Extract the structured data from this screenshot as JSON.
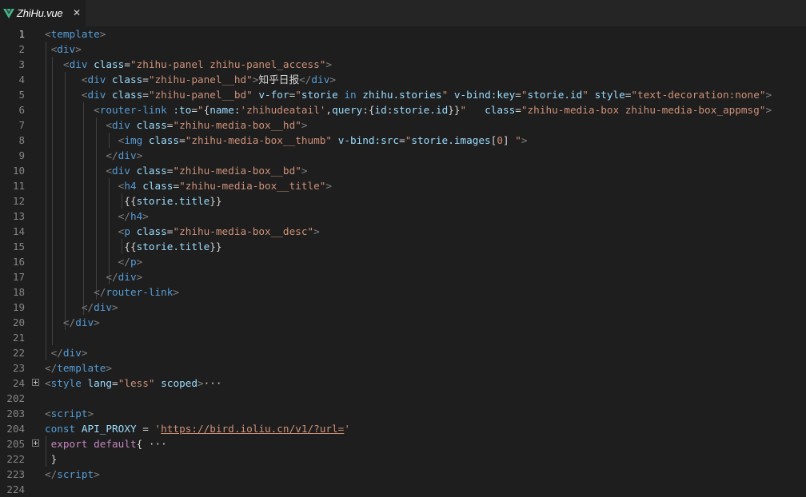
{
  "tab": {
    "filename": "ZhiHu.vue",
    "close_glyph": "✕",
    "icon": "vue-icon"
  },
  "colors": {
    "tag": "#569cd6",
    "attribute": "#9cdcfe",
    "string": "#ce9178",
    "punctuation": "#808080",
    "text": "#d4d4d4",
    "keyword": "#c586c0",
    "line_number": "#858585",
    "background": "#1e1e1e"
  },
  "lines": [
    {
      "n": "1",
      "t": [
        [
          "p",
          "<"
        ],
        [
          "tag",
          "template"
        ],
        [
          "p",
          ">"
        ]
      ]
    },
    {
      "n": "2",
      "t": [
        [
          "txt",
          " "
        ],
        [
          "p",
          "<"
        ],
        [
          "tag",
          "div"
        ],
        [
          "p",
          ">"
        ]
      ]
    },
    {
      "n": "3",
      "t": [
        [
          "txt",
          "   "
        ],
        [
          "p",
          "<"
        ],
        [
          "tag",
          "div"
        ],
        [
          "txt",
          " "
        ],
        [
          "attr",
          "class"
        ],
        [
          "txt",
          "="
        ],
        [
          "str",
          "\"zhihu-panel zhihu-panel_access\""
        ],
        [
          "p",
          ">"
        ]
      ]
    },
    {
      "n": "4",
      "t": [
        [
          "txt",
          "      "
        ],
        [
          "p",
          "<"
        ],
        [
          "tag",
          "div"
        ],
        [
          "txt",
          " "
        ],
        [
          "attr",
          "class"
        ],
        [
          "txt",
          "="
        ],
        [
          "str",
          "\"zhihu-panel__hd\""
        ],
        [
          "p",
          ">"
        ],
        [
          "txt",
          "知乎日报"
        ],
        [
          "p",
          "</"
        ],
        [
          "tag",
          "div"
        ],
        [
          "p",
          ">"
        ]
      ]
    },
    {
      "n": "5",
      "t": [
        [
          "txt",
          "      "
        ],
        [
          "p",
          "<"
        ],
        [
          "tag",
          "div"
        ],
        [
          "txt",
          " "
        ],
        [
          "attr",
          "class"
        ],
        [
          "txt",
          "="
        ],
        [
          "str",
          "\"zhihu-panel__bd\""
        ],
        [
          "txt",
          " "
        ],
        [
          "attr",
          "v-for"
        ],
        [
          "txt",
          "="
        ],
        [
          "str",
          "\""
        ],
        [
          "var",
          "storie"
        ],
        [
          "txt",
          " "
        ],
        [
          "tag",
          "in"
        ],
        [
          "txt",
          " "
        ],
        [
          "var",
          "zhihu.stories"
        ],
        [
          "str",
          "\""
        ],
        [
          "txt",
          " "
        ],
        [
          "attr",
          "v-bind:key"
        ],
        [
          "txt",
          "="
        ],
        [
          "str",
          "\""
        ],
        [
          "var",
          "storie.id"
        ],
        [
          "str",
          "\""
        ],
        [
          "txt",
          " "
        ],
        [
          "attr",
          "style"
        ],
        [
          "txt",
          "="
        ],
        [
          "str",
          "\"text-decoration:none\""
        ],
        [
          "p",
          ">"
        ]
      ]
    },
    {
      "n": "6",
      "t": [
        [
          "txt",
          "        "
        ],
        [
          "p",
          "<"
        ],
        [
          "tag",
          "router-link"
        ],
        [
          "txt",
          " "
        ],
        [
          "attr",
          ":to"
        ],
        [
          "txt",
          "="
        ],
        [
          "str",
          "\""
        ],
        [
          "txt",
          "{"
        ],
        [
          "var",
          "name"
        ],
        [
          "txt",
          ":"
        ],
        [
          "str",
          "'zhihudeatail'"
        ],
        [
          "txt",
          ","
        ],
        [
          "var",
          "query"
        ],
        [
          "txt",
          ":{"
        ],
        [
          "var",
          "id"
        ],
        [
          "txt",
          ":"
        ],
        [
          "var",
          "storie.id"
        ],
        [
          "txt",
          "}}"
        ],
        [
          "str",
          "\""
        ],
        [
          "txt",
          "   "
        ],
        [
          "attr",
          "class"
        ],
        [
          "txt",
          "="
        ],
        [
          "str",
          "\"zhihu-media-box zhihu-media-box_appmsg\""
        ],
        [
          "p",
          ">"
        ]
      ]
    },
    {
      "n": "7",
      "t": [
        [
          "txt",
          "          "
        ],
        [
          "p",
          "<"
        ],
        [
          "tag",
          "div"
        ],
        [
          "txt",
          " "
        ],
        [
          "attr",
          "class"
        ],
        [
          "txt",
          "="
        ],
        [
          "str",
          "\"zhihu-media-box__hd\""
        ],
        [
          "p",
          ">"
        ]
      ]
    },
    {
      "n": "8",
      "t": [
        [
          "txt",
          "            "
        ],
        [
          "p",
          "<"
        ],
        [
          "tag",
          "img"
        ],
        [
          "txt",
          " "
        ],
        [
          "attr",
          "class"
        ],
        [
          "txt",
          "="
        ],
        [
          "str",
          "\"zhihu-media-box__thumb\""
        ],
        [
          "txt",
          " "
        ],
        [
          "attr",
          "v-bind:src"
        ],
        [
          "txt",
          "="
        ],
        [
          "str",
          "\""
        ],
        [
          "var",
          "storie.images"
        ],
        [
          "txt",
          "["
        ],
        [
          "str",
          "0"
        ],
        [
          "txt",
          "] "
        ],
        [
          "str",
          "\""
        ],
        [
          "p",
          ">"
        ]
      ]
    },
    {
      "n": "9",
      "t": [
        [
          "txt",
          "          "
        ],
        [
          "p",
          "</"
        ],
        [
          "tag",
          "div"
        ],
        [
          "p",
          ">"
        ]
      ]
    },
    {
      "n": "10",
      "t": [
        [
          "txt",
          "          "
        ],
        [
          "p",
          "<"
        ],
        [
          "tag",
          "div"
        ],
        [
          "txt",
          " "
        ],
        [
          "attr",
          "class"
        ],
        [
          "txt",
          "="
        ],
        [
          "str",
          "\"zhihu-media-box__bd\""
        ],
        [
          "p",
          ">"
        ]
      ]
    },
    {
      "n": "11",
      "t": [
        [
          "txt",
          "            "
        ],
        [
          "p",
          "<"
        ],
        [
          "tag",
          "h4"
        ],
        [
          "txt",
          " "
        ],
        [
          "attr",
          "class"
        ],
        [
          "txt",
          "="
        ],
        [
          "str",
          "\"zhihu-media-box__title\""
        ],
        [
          "p",
          ">"
        ]
      ]
    },
    {
      "n": "12",
      "t": [
        [
          "txt",
          "             {{"
        ],
        [
          "var",
          "storie.title"
        ],
        [
          "txt",
          "}}"
        ]
      ]
    },
    {
      "n": "13",
      "t": [
        [
          "txt",
          "            "
        ],
        [
          "p",
          "</"
        ],
        [
          "tag",
          "h4"
        ],
        [
          "p",
          ">"
        ]
      ]
    },
    {
      "n": "14",
      "t": [
        [
          "txt",
          "            "
        ],
        [
          "p",
          "<"
        ],
        [
          "tag",
          "p"
        ],
        [
          "txt",
          " "
        ],
        [
          "attr",
          "class"
        ],
        [
          "txt",
          "="
        ],
        [
          "str",
          "\"zhihu-media-box__desc\""
        ],
        [
          "p",
          ">"
        ]
      ]
    },
    {
      "n": "15",
      "t": [
        [
          "txt",
          "             {{"
        ],
        [
          "var",
          "storie.title"
        ],
        [
          "txt",
          "}}"
        ]
      ]
    },
    {
      "n": "16",
      "t": [
        [
          "txt",
          "            "
        ],
        [
          "p",
          "</"
        ],
        [
          "tag",
          "p"
        ],
        [
          "p",
          ">"
        ]
      ]
    },
    {
      "n": "17",
      "t": [
        [
          "txt",
          "          "
        ],
        [
          "p",
          "</"
        ],
        [
          "tag",
          "div"
        ],
        [
          "p",
          ">"
        ]
      ]
    },
    {
      "n": "18",
      "t": [
        [
          "txt",
          "        "
        ],
        [
          "p",
          "</"
        ],
        [
          "tag",
          "router-link"
        ],
        [
          "p",
          ">"
        ]
      ]
    },
    {
      "n": "19",
      "t": [
        [
          "txt",
          "      "
        ],
        [
          "p",
          "</"
        ],
        [
          "tag",
          "div"
        ],
        [
          "p",
          ">"
        ]
      ]
    },
    {
      "n": "20",
      "t": [
        [
          "txt",
          "   "
        ],
        [
          "p",
          "</"
        ],
        [
          "tag",
          "div"
        ],
        [
          "p",
          ">"
        ]
      ]
    },
    {
      "n": "21",
      "t": []
    },
    {
      "n": "22",
      "t": [
        [
          "txt",
          " "
        ],
        [
          "p",
          "</"
        ],
        [
          "tag",
          "div"
        ],
        [
          "p",
          ">"
        ]
      ]
    },
    {
      "n": "23",
      "t": [
        [
          "p",
          "</"
        ],
        [
          "tag",
          "template"
        ],
        [
          "p",
          ">"
        ]
      ]
    },
    {
      "n": "24",
      "fold": true,
      "t": [
        [
          "p",
          "<"
        ],
        [
          "tag",
          "style"
        ],
        [
          "txt",
          " "
        ],
        [
          "attr",
          "lang"
        ],
        [
          "txt",
          "="
        ],
        [
          "str",
          "\"less\""
        ],
        [
          "txt",
          " "
        ],
        [
          "attr",
          "scoped"
        ],
        [
          "p",
          ">"
        ],
        [
          "txt",
          "···"
        ]
      ]
    },
    {
      "n": "202",
      "t": []
    },
    {
      "n": "203",
      "t": [
        [
          "p",
          "<"
        ],
        [
          "tag",
          "script"
        ],
        [
          "p",
          ">"
        ]
      ]
    },
    {
      "n": "204",
      "t": [
        [
          "kw",
          "const"
        ],
        [
          "txt",
          " "
        ],
        [
          "var",
          "API_PROXY"
        ],
        [
          "txt",
          " = "
        ],
        [
          "str",
          "'"
        ],
        [
          "link",
          "https://bird.ioliu.cn/v1/?url="
        ],
        [
          "str",
          "'"
        ]
      ]
    },
    {
      "n": "205",
      "fold": true,
      "t": [
        [
          "txt",
          " "
        ],
        [
          "ctl",
          "export"
        ],
        [
          "txt",
          " "
        ],
        [
          "ctl",
          "default"
        ],
        [
          "txt",
          "{ ···"
        ]
      ]
    },
    {
      "n": "222",
      "t": [
        [
          "txt",
          " }"
        ]
      ]
    },
    {
      "n": "223",
      "t": [
        [
          "p",
          "</"
        ],
        [
          "tag",
          "script"
        ],
        [
          "p",
          ">"
        ]
      ]
    },
    {
      "n": "224",
      "t": []
    }
  ]
}
